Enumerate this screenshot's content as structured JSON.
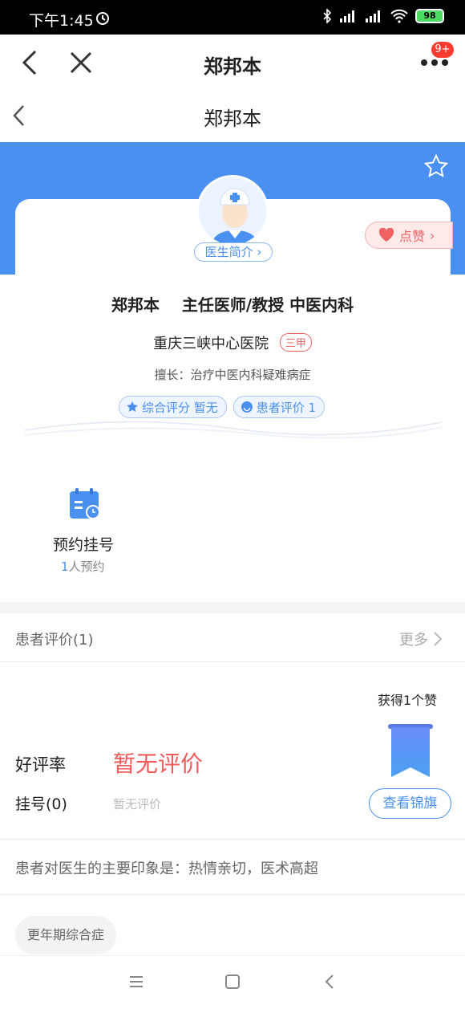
{
  "status_bar": {
    "time": "下午1:45",
    "battery": "98"
  },
  "top_nav": {
    "title": "郑邦本",
    "badge": "9+"
  },
  "sub_nav": {
    "title": "郑邦本"
  },
  "doctor": {
    "intro_label": "医生简介",
    "like_label": "点赞",
    "name": "郑邦本",
    "title_dept": "主任医师/教授 中医内科",
    "hospital": "重庆三峡中心医院",
    "hospital_level": "三甲",
    "skill": "擅长：治疗中医内科疑难病症",
    "chips": [
      "综合评分 暂无",
      "患者评价 1"
    ]
  },
  "appointment": {
    "label": "预约挂号",
    "count": "1",
    "count_suffix": "人预约"
  },
  "reviews": {
    "header": "患者评价(1)",
    "more": "更多",
    "likes": "获得1个赞",
    "good_rate_label": "好评率",
    "good_rate_value": "暂无评价",
    "register_label": "挂号(0)",
    "register_value": "暂无评价",
    "flag_button": "查看锦旗",
    "impression": "患者对医生的主要印象是：热情亲切，医术高超",
    "tags": [
      "更年期综合症"
    ]
  },
  "colors": {
    "accent": "#4a90f0",
    "danger": "#f05a5a"
  }
}
